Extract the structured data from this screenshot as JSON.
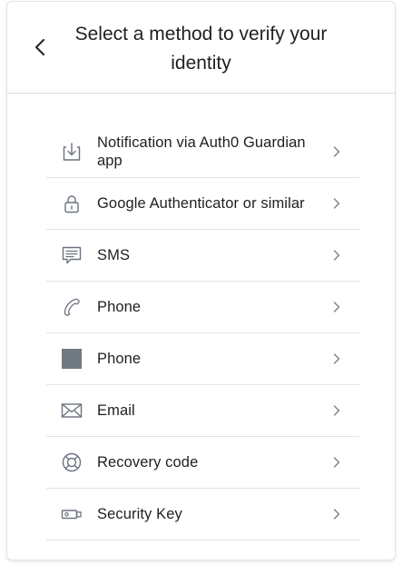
{
  "header": {
    "back_icon": "chevron-left-icon",
    "title": "Select a method to verify your identity"
  },
  "methods": [
    {
      "label": "Notification via Auth0 Guardian app",
      "icon": "download-tray-icon"
    },
    {
      "label": "Google Authenticator or similar",
      "icon": "lock-icon"
    },
    {
      "label": "SMS",
      "icon": "message-icon"
    },
    {
      "label": "Phone",
      "icon": "phone-icon"
    },
    {
      "label": "Phone",
      "icon": "square-placeholder-icon"
    },
    {
      "label": "Email",
      "icon": "envelope-icon"
    },
    {
      "label": "Recovery code",
      "icon": "lifebuoy-icon"
    },
    {
      "label": "Security Key",
      "icon": "usb-key-icon"
    }
  ],
  "colors": {
    "text": "#1f1f1f",
    "icon": "#6b7280",
    "divider": "#e3e3e3",
    "placeholder_square": "#707880"
  }
}
